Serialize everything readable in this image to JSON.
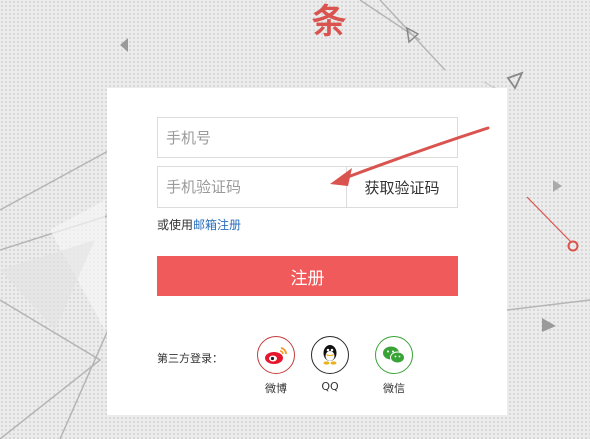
{
  "headline": {
    "visible_text": "条",
    "color": "#d9534f"
  },
  "form": {
    "phone_placeholder": "手机号",
    "code_placeholder": "手机验证码",
    "get_code_label": "获取验证码",
    "alt_prefix": "或使用",
    "alt_link": "邮箱注册",
    "register_label": "注册"
  },
  "third_party": {
    "label": "第三方登录：",
    "providers": [
      {
        "name": "微博",
        "icon": "weibo-icon",
        "color": "#c63d3d"
      },
      {
        "name": "QQ",
        "icon": "qq-penguin-icon",
        "color": "#2a2a2a"
      },
      {
        "name": "微信",
        "icon": "wechat-icon",
        "color": "#3aa338"
      }
    ]
  },
  "colors": {
    "primary_button": "#f05a5a",
    "link": "#2a6ebd",
    "arrow": "#d9534f"
  }
}
